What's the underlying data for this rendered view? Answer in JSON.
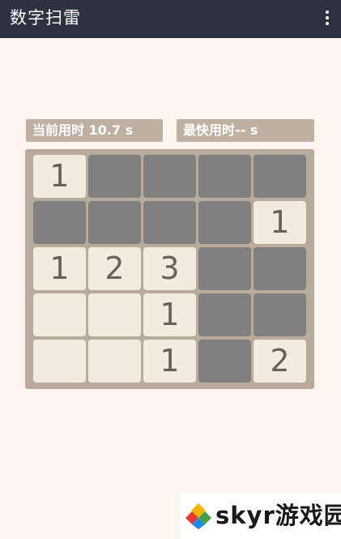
{
  "app": {
    "title": "数字扫雷"
  },
  "timers": {
    "current": "当前用时 10.7 s",
    "best": "最快用时-- s"
  },
  "board": {
    "rows": 5,
    "cols": 5,
    "cells": [
      [
        "1",
        null,
        null,
        null,
        null
      ],
      [
        null,
        null,
        null,
        null,
        "1"
      ],
      [
        "1",
        "2",
        "3",
        null,
        null
      ],
      [
        "",
        "",
        "1",
        null,
        null
      ],
      [
        "",
        "",
        "1",
        null,
        "2"
      ]
    ]
  },
  "watermark": {
    "text": "skyr游戏园"
  },
  "colors": {
    "appbar": "#2d3142",
    "background": "#fcf6ee",
    "timer_bg": "#bfb0a2",
    "board_bg": "#b8ab9c",
    "hidden_cell": "#808080",
    "revealed_cell": "#f3ebde",
    "number_text": "#6a625a"
  }
}
